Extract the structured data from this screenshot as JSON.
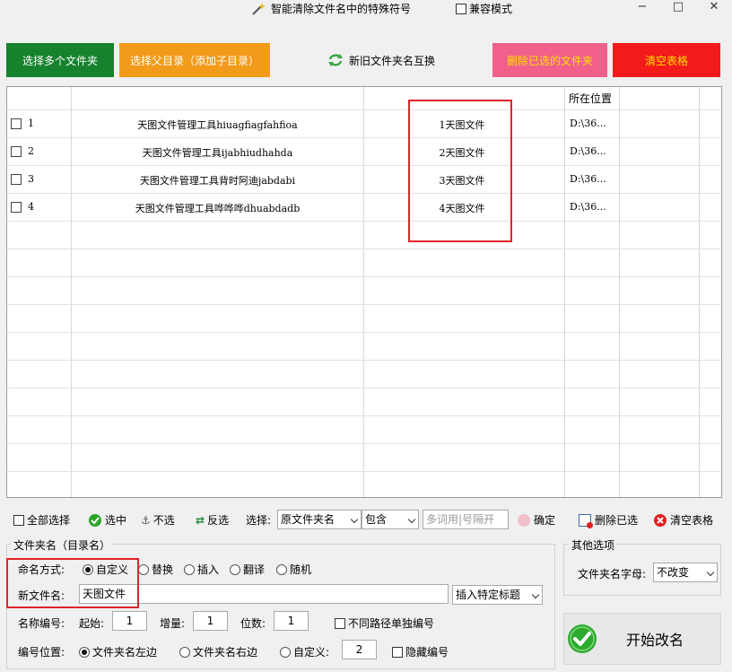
{
  "window": {
    "title": "智能清除文件名中的特殊符号",
    "compat_mode_label": "兼容模式",
    "compat_mode_checked": false,
    "minimize_glyph": "−",
    "maximize_glyph": "□",
    "close_glyph": "✕"
  },
  "top_buttons": {
    "select_folders": "选择多个文件夹",
    "select_parent": "选择父目录（添加子目录）",
    "swap_names": "新旧文件夹名互换",
    "delete_selected": "删除已选的文件夹",
    "clear_table": "清空表格"
  },
  "table": {
    "location_header": "所在位置",
    "rows": [
      {
        "index": "1",
        "old_name": "天图文件管理工具hiuagfiagfahfioa",
        "new_name": "1天图文件",
        "location": "D:\\36..."
      },
      {
        "index": "2",
        "old_name": "天图文件管理工具ijabhiudhahda",
        "new_name": "2天图文件",
        "location": "D:\\36..."
      },
      {
        "index": "3",
        "old_name": "天图文件管理工具背时阿迪jabdabi",
        "new_name": "3天图文件",
        "location": "D:\\36..."
      },
      {
        "index": "4",
        "old_name": "天图文件管理工具哗哗哗dhuabdadb",
        "new_name": "4天图文件",
        "location": "D:\\36..."
      }
    ]
  },
  "toolbar": {
    "select_all": "全部选择",
    "check": "选中",
    "uncheck": "不选",
    "invert": "反选",
    "select_label": "选择:",
    "field_value": "原文件夹名",
    "match_value": "包含",
    "keyword_placeholder": "多词用|号隔开",
    "confirm": "确定",
    "delete_selected": "删除已选",
    "clear_table": "清空表格"
  },
  "folder_name_group": {
    "title": "文件夹名（目录名）",
    "naming_mode_label": "命名方式:",
    "modes": [
      "自定义",
      "替换",
      "插入",
      "翻译",
      "随机"
    ],
    "selected_mode": "自定义",
    "new_name_label": "新文件名:",
    "new_name_value": "天图文件",
    "insert_title_value": "插入特定标题",
    "numbering_label": "名称编号:",
    "start_label": "起始:",
    "start_value": "1",
    "increment_label": "增量:",
    "increment_value": "1",
    "digits_label": "位数:",
    "digits_value": "1",
    "separate_numbering_label": "不同路径单独编号",
    "position_label": "编号位置:",
    "positions": [
      "文件夹名左边",
      "文件夹名右边",
      "自定义:"
    ],
    "selected_position": "文件夹名左边",
    "custom_position_value": "2",
    "hide_numbering_label": "隐藏编号"
  },
  "other_options": {
    "title": "其他选项",
    "letter_case_label": "文件夹名字母:",
    "letter_case_value": "不改变"
  },
  "start_button": "开始改名",
  "colors": {
    "green": "#16822d",
    "orange": "#f29a1a",
    "pink": "#f0608a",
    "red": "#f21a1a",
    "highlight": "#e0232a"
  }
}
